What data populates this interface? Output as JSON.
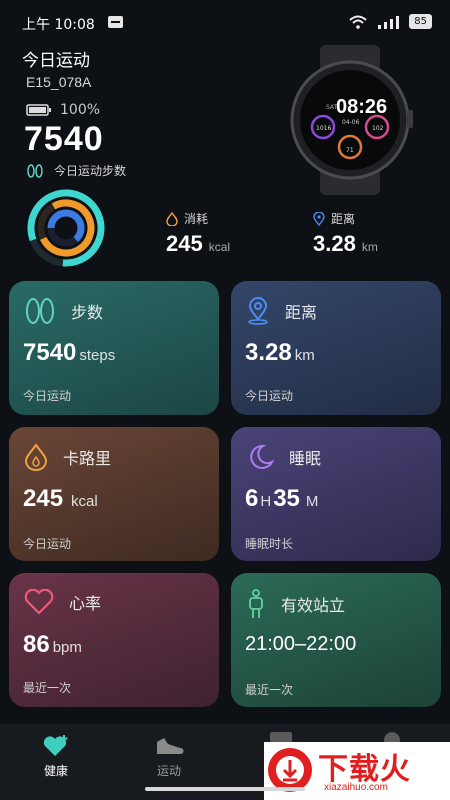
{
  "status_bar": {
    "time": "上午 10:08",
    "battery": "85"
  },
  "header": {
    "title": "今日运动",
    "device_id": "E15_078A",
    "battery_percent": "100%",
    "steps": "7540",
    "steps_label": "今日运动步数"
  },
  "watch_face": {
    "time": "08:26",
    "date": "04-06",
    "day": "SAT",
    "left": "1016",
    "right": "102",
    "bottom": "71"
  },
  "summary": {
    "calories": {
      "label": "消耗",
      "value": "245",
      "unit": "kcal"
    },
    "distance": {
      "label": "距离",
      "value": "3.28",
      "unit": "km"
    }
  },
  "cards": {
    "steps": {
      "title": "步数",
      "value": "7540",
      "unit": "steps",
      "sub": "今日运动"
    },
    "distance": {
      "title": "距离",
      "value": "3.28",
      "unit": "km",
      "sub": "今日运动"
    },
    "calories": {
      "title": "卡路里",
      "value": "245",
      "unit": "kcal",
      "sub": "今日运动"
    },
    "sleep": {
      "title": "睡眠",
      "hours": "6",
      "h_unit": "H",
      "minutes": "35",
      "m_unit": "M",
      "sub": "睡眠时长"
    },
    "heart": {
      "title": "心率",
      "value": "86",
      "unit": "bpm",
      "sub": "最近一次"
    },
    "standing": {
      "title": "有效站立",
      "value": "21:00–22:00",
      "sub": "最近一次"
    }
  },
  "tabs": [
    {
      "label": "健康",
      "icon": "heart-plus-icon"
    },
    {
      "label": "运动",
      "icon": "shoe-icon"
    }
  ],
  "watermark": {
    "text": "下载火",
    "sub": "xiazaihuo.com"
  },
  "colors": {
    "background": "#0d1014",
    "steps_card": "#1f5a57",
    "distance_card": "#2a3a55",
    "calories_card": "#5a3d2f",
    "sleep_card": "#3f3a66",
    "heart_card": "#5a2e3e",
    "standing_card": "#2c5a4c",
    "active_tab": "#3fcfbf"
  }
}
